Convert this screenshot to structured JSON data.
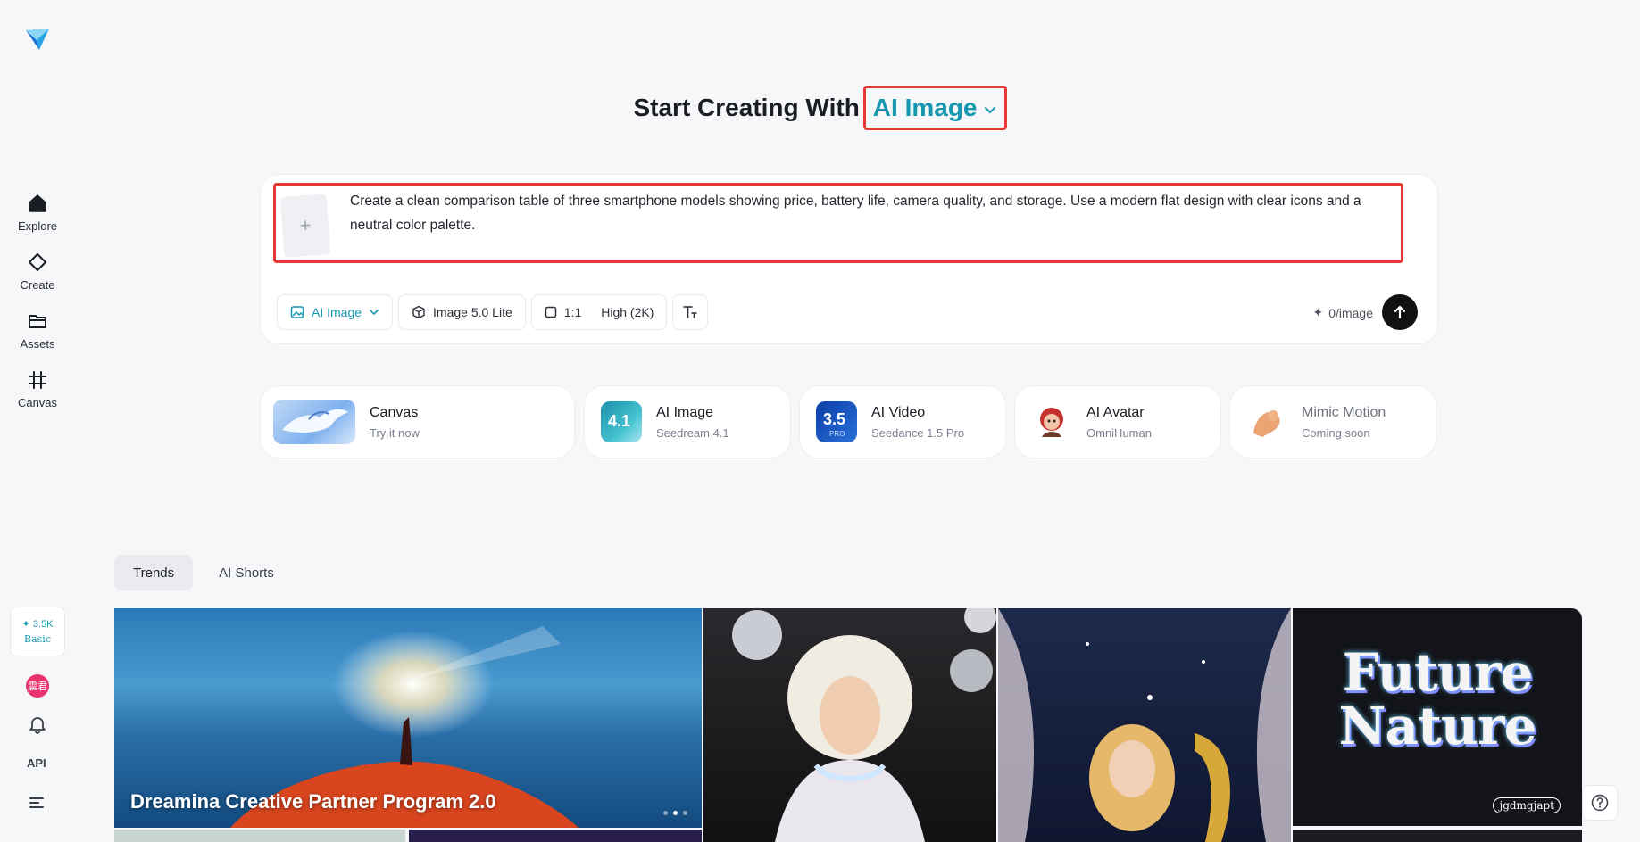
{
  "sidebar": {
    "items": [
      {
        "label": "Explore",
        "icon": "home-icon"
      },
      {
        "label": "Create",
        "icon": "diamond-icon"
      },
      {
        "label": "Assets",
        "icon": "folder-icon"
      },
      {
        "label": "Canvas",
        "icon": "frame-icon"
      }
    ],
    "credits": "✦ 3.5K",
    "plan": "Basic",
    "avatar_text": "震君",
    "api_label": "API"
  },
  "heading": {
    "prefix": "Start Creating With",
    "mode": "AI Image"
  },
  "prompt": {
    "add_symbol": "+",
    "text": "Create a clean comparison table of three smartphone models showing price, battery life, camera quality, and storage. Use a modern flat design with clear icons and a neutral color palette."
  },
  "toolbar": {
    "mode_label": "AI Image",
    "model_label": "Image 5.0 Lite",
    "ratio_label": "1:1",
    "quality_label": "High (2K)",
    "cost_label": "0/image"
  },
  "tools": [
    {
      "title": "Canvas",
      "subtitle": "Try it now"
    },
    {
      "title": "AI Image",
      "subtitle": "Seedream 4.1",
      "badge": "4.1"
    },
    {
      "title": "AI Video",
      "subtitle": "Seedance 1.5 Pro",
      "badge": "3.5",
      "badge_sub": "PRO"
    },
    {
      "title": "AI Avatar",
      "subtitle": "OmniHuman"
    },
    {
      "title": "Mimic Motion",
      "subtitle": "Coming soon"
    }
  ],
  "tabs": [
    "Trends",
    "AI Shorts"
  ],
  "gallery": {
    "featured_caption": "Dreamina Creative Partner Program 2.0",
    "future_title_line1": "Future",
    "future_title_line2": "Nature",
    "future_signature": "jgdmgjapt"
  },
  "colors": {
    "accent": "#1597b0",
    "highlight_border": "#e53935",
    "send_button": "#111111"
  }
}
